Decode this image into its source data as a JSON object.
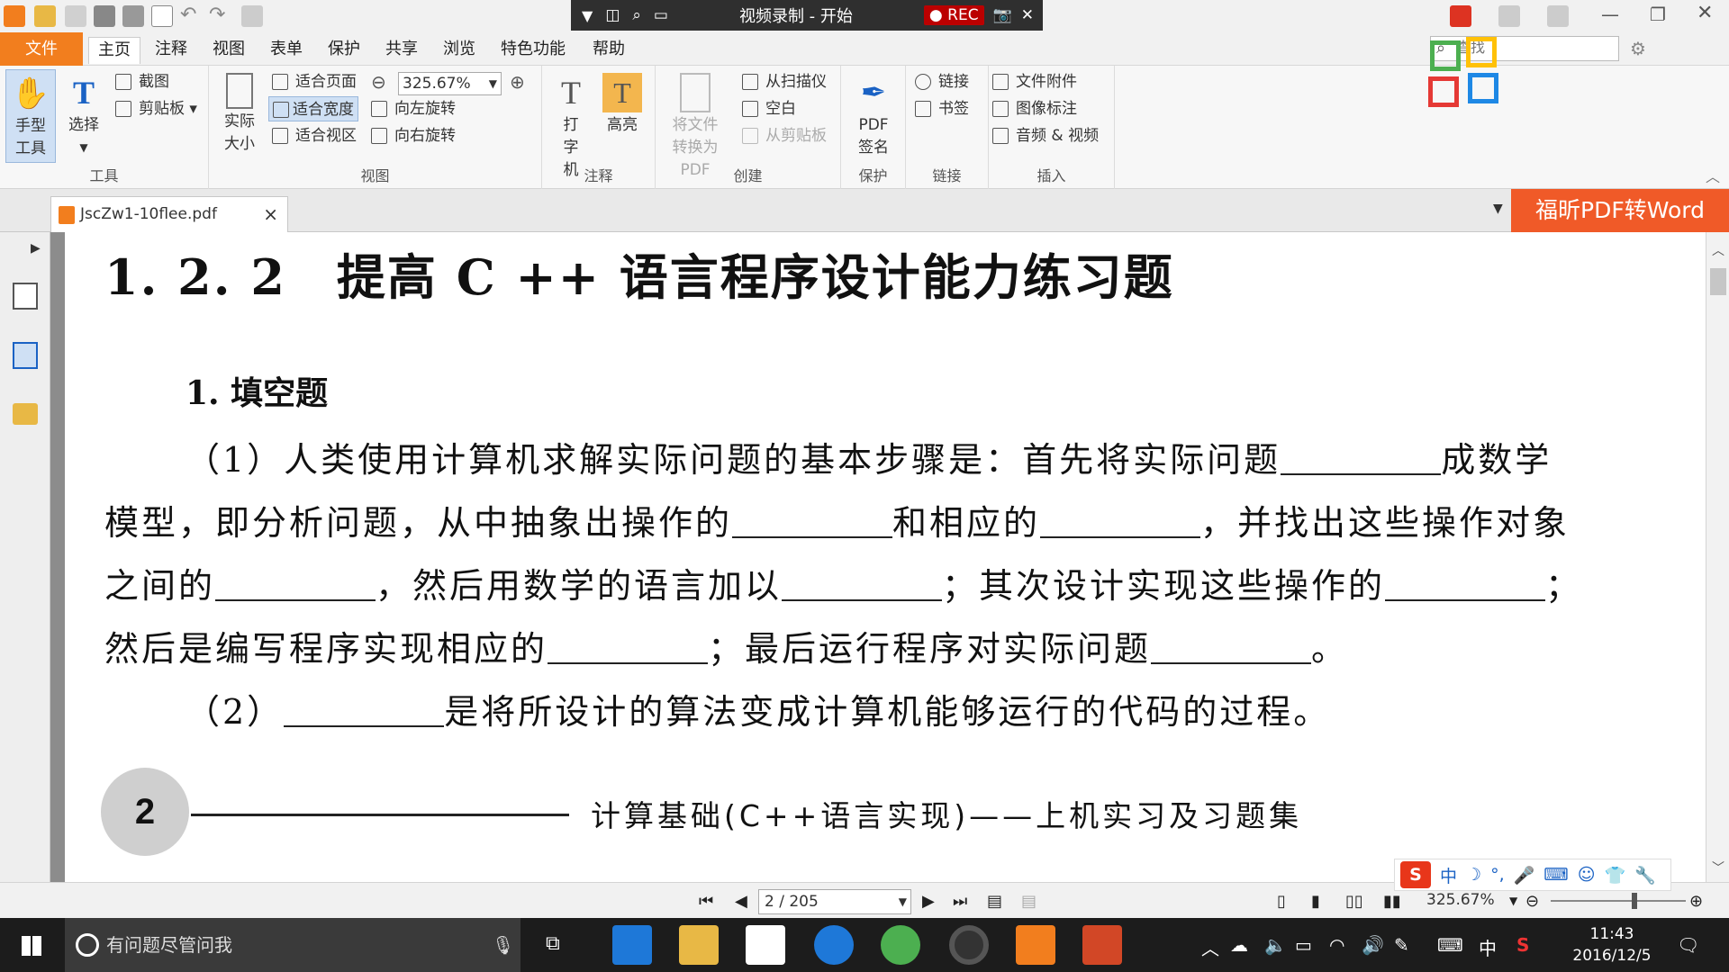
{
  "quick_access": {
    "undo": "↶",
    "redo": "↷"
  },
  "recorder": {
    "title": "视频录制 - 开始",
    "rec_label": "REC"
  },
  "search": {
    "placeholder": "查找"
  },
  "menu": {
    "file": "文件",
    "items": [
      "主页",
      "注释",
      "视图",
      "表单",
      "保护",
      "共享",
      "浏览",
      "特色功能",
      "帮助"
    ]
  },
  "ribbon": {
    "tools": {
      "hand": "手型工具",
      "select": "选择",
      "snapshot": "截图",
      "clipboard": "剪贴板",
      "label": "工具"
    },
    "view": {
      "actual_size": "实际大小",
      "fit_page": "适合页面",
      "fit_width": "适合宽度",
      "fit_visible": "适合视区",
      "zoom": "325.67%",
      "rotate_left": "向左旋转",
      "rotate_right": "向右旋转",
      "label": "视图"
    },
    "comment": {
      "typewriter": "打字机",
      "highlight": "高亮",
      "label": "注释"
    },
    "create": {
      "convert": "将文件转换为PDF",
      "from_scanner": "从扫描仪",
      "blank": "空白",
      "from_clipboard": "从剪贴板",
      "label": "创建"
    },
    "protect": {
      "sign": "PDF签名",
      "label": "保护"
    },
    "links": {
      "link": "链接",
      "bookmark": "书签",
      "label": "链接"
    },
    "insert": {
      "attachment": "文件附件",
      "image": "图像标注",
      "audio_video": "音频 & 视频",
      "label": "插入"
    }
  },
  "tab": {
    "filename": "JscZw1-10flee.pdf",
    "close": "×"
  },
  "convert_button": "福昕PDF转Word",
  "document": {
    "heading": "1. 2. 2　提高 C ++ 语言程序设计能力练习题",
    "section": "1. 填空题",
    "p1a": "（1）人类使用计算机求解实际问题的基本步骤是：首先将实际问题",
    "p1b": "成数学",
    "p2a": "模型，即分析问题，从中抽象出操作的",
    "p2b": "和相应的",
    "p2c": "，并找出这些操作对象",
    "p3a": "之间的",
    "p3b": "，然后用数学的语言加以",
    "p3c": "；其次设计实现这些操作的",
    "p3d": "；",
    "p4a": "然后是编写程序实现相应的",
    "p4b": "；最后运行程序对实际问题",
    "p4c": "。",
    "p5a": "（2）",
    "p5b": "是将所设计的算法变成计算机能够运行的代码的过程。",
    "page_number": "2",
    "footer": "计算基础(C++语言实现)——上机实习及习题集"
  },
  "status": {
    "page": "2 / 205",
    "zoom": "325.67%"
  },
  "ime": {
    "lang": "中"
  },
  "taskbar": {
    "search": "有问题尽管问我",
    "time": "11:43",
    "date": "2016/12/5",
    "ime_lang": "中"
  },
  "colors": {
    "accent": "#f27e1e",
    "convert": "#f05a28"
  }
}
